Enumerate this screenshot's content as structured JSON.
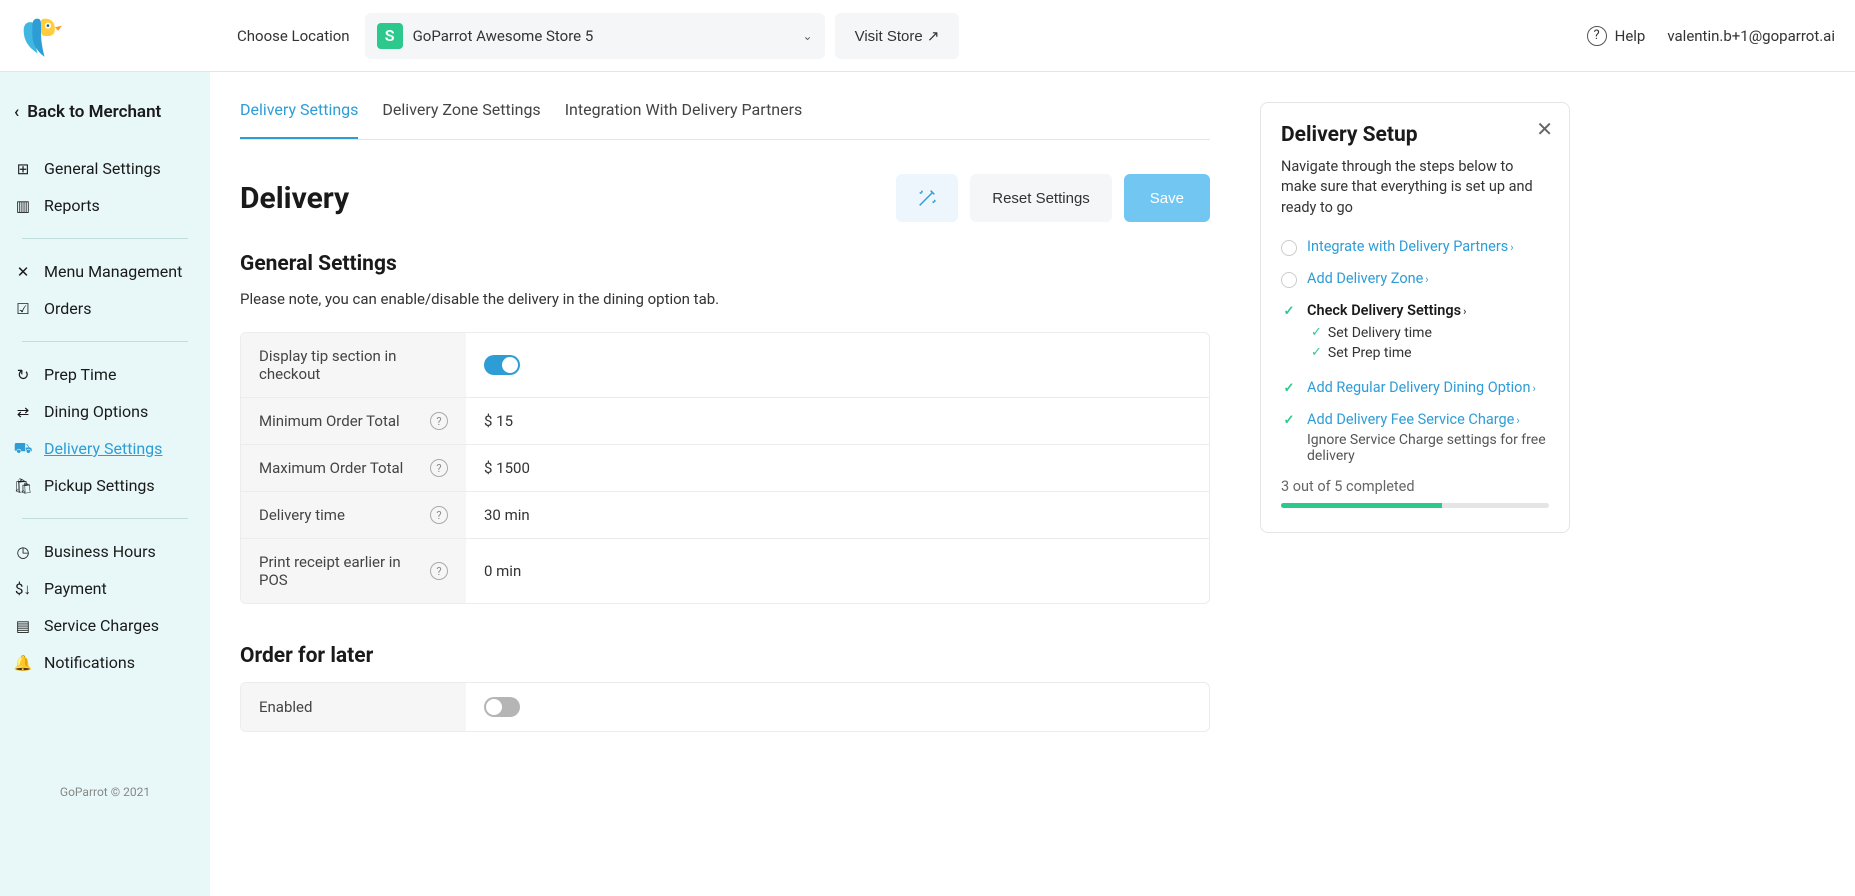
{
  "header": {
    "choose_location_label": "Choose Location",
    "location_badge": "S",
    "location_name": "GoParrot Awesome Store 5",
    "visit_store": "Visit Store ↗",
    "help": "Help",
    "user_email": "valentin.b+1@goparrot.ai"
  },
  "sidebar": {
    "back": "Back to Merchant",
    "items": [
      {
        "label": "General Settings",
        "icon": "grid"
      },
      {
        "label": "Reports",
        "icon": "report"
      }
    ],
    "group2": [
      {
        "label": "Menu Management",
        "icon": "cutlery"
      },
      {
        "label": "Orders",
        "icon": "check-square"
      }
    ],
    "group3": [
      {
        "label": "Prep Time",
        "icon": "clock"
      },
      {
        "label": "Dining Options",
        "icon": "options"
      },
      {
        "label": "Delivery Settings",
        "icon": "truck",
        "active": true
      },
      {
        "label": "Pickup Settings",
        "icon": "bag"
      }
    ],
    "group4": [
      {
        "label": "Business Hours",
        "icon": "hours"
      },
      {
        "label": "Payment",
        "icon": "payment"
      },
      {
        "label": "Service Charges",
        "icon": "charges"
      },
      {
        "label": "Notifications",
        "icon": "bell"
      }
    ],
    "footer": "GoParrot © 2021"
  },
  "tabs": [
    {
      "label": "Delivery Settings",
      "active": true
    },
    {
      "label": "Delivery Zone Settings"
    },
    {
      "label": "Integration With Delivery Partners"
    }
  ],
  "page": {
    "title": "Delivery",
    "reset": "Reset Settings",
    "save": "Save"
  },
  "general": {
    "title": "General Settings",
    "note": "Please note, you can enable/disable the delivery in the dining option tab.",
    "rows": {
      "tip": {
        "label": "Display tip section in checkout",
        "value_toggle": true
      },
      "min": {
        "label": "Minimum Order Total",
        "value": "$ 15"
      },
      "max": {
        "label": "Maximum Order Total",
        "value": "$ 1500"
      },
      "dtime": {
        "label": "Delivery time",
        "value": "30 min"
      },
      "receipt": {
        "label": "Print receipt earlier in POS",
        "value": "0 min"
      }
    }
  },
  "later": {
    "title": "Order for later",
    "rows": {
      "enabled": {
        "label": "Enabled",
        "value_toggle": false
      }
    }
  },
  "setup": {
    "title": "Delivery Setup",
    "desc": "Navigate through the steps below to make sure that everything is set up and ready to go",
    "steps": {
      "s1": {
        "label": "Integrate with Delivery Partners"
      },
      "s2": {
        "label": "Add Delivery Zone"
      },
      "s3": {
        "label": "Check Delivery Settings",
        "sub1": "Set Delivery time",
        "sub2": "Set Prep time"
      },
      "s4": {
        "label": "Add Regular Delivery Dining Option"
      },
      "s5": {
        "label": "Add Delivery Fee Service Charge",
        "note": "Ignore Service Charge settings for free delivery"
      }
    },
    "progress_text": "3 out of 5 completed",
    "progress_pct": 60
  }
}
